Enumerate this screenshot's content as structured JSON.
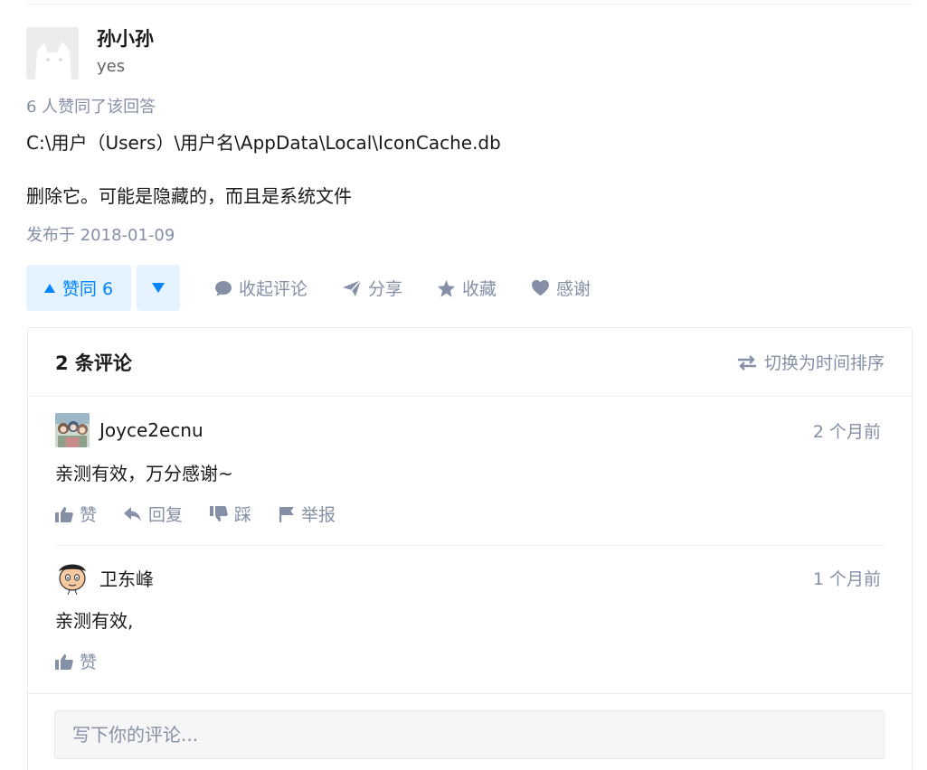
{
  "author": {
    "name": "孙小孙",
    "headline": "yes"
  },
  "answer": {
    "voters_text": "6 人赞同了该回答",
    "paragraphs": [
      "C:\\用户（Users）\\用户名\\AppData\\Local\\IconCache.db",
      "删除它。可能是隐藏的，而且是系统文件"
    ],
    "published": "发布于 2018-01-09"
  },
  "actions": {
    "vote_up_label": "赞同 6",
    "collapse_comments": "收起评论",
    "share": "分享",
    "favorite": "收藏",
    "thanks": "感谢"
  },
  "comments": {
    "title": "2 条评论",
    "sort_switch": "切换为时间排序",
    "items": [
      {
        "user": "Joyce2ecnu",
        "time": "2 个月前",
        "text": "亲测有效，万分感谢~",
        "actions": [
          "赞",
          "回复",
          "踩",
          "举报"
        ]
      },
      {
        "user": "卫东峰",
        "time": "1 个月前",
        "text": "亲测有效,",
        "actions": [
          "赞"
        ]
      }
    ],
    "input_placeholder": "写下你的评论..."
  },
  "colors": {
    "accent": "#0084ff",
    "accent_bg": "#e5f2ff",
    "muted": "#8590a6",
    "text": "#1a1a1a"
  },
  "icons": [
    "triangle-up-icon",
    "triangle-down-icon",
    "comment-bubble-icon",
    "paper-plane-icon",
    "star-icon",
    "heart-icon",
    "swap-arrows-icon",
    "thumb-up-icon",
    "reply-arrow-icon",
    "thumb-down-icon",
    "flag-icon"
  ]
}
